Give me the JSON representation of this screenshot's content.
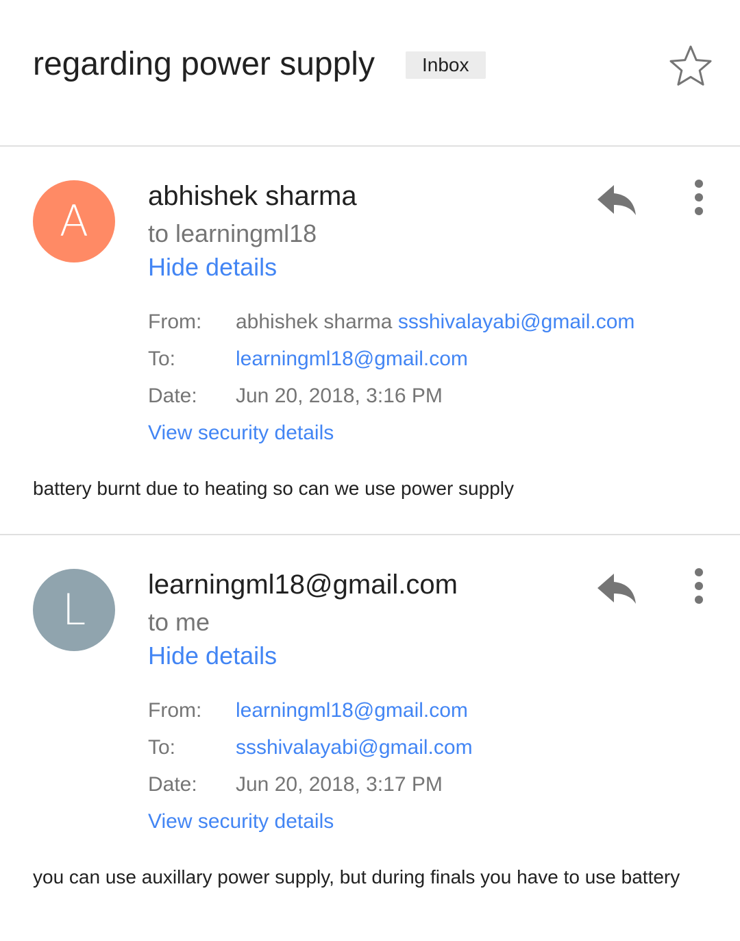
{
  "subject": "regarding power supply",
  "label": "Inbox",
  "colors": {
    "link": "#4285f4",
    "avatar_a": "#ff8a65",
    "avatar_l": "#90a4ae",
    "muted": "#757575"
  },
  "messages": [
    {
      "avatar_letter": "A",
      "sender": "abhishek sharma",
      "recipient_summary": "to learningml18",
      "hide_details": "Hide details",
      "from_label": "From:",
      "from_name": "abhishek sharma",
      "from_email": "ssshivalayabi@gmail.com",
      "to_label": "To:",
      "to_email": "learningml18@gmail.com",
      "date_label": "Date:",
      "date": "Jun 20, 2018, 3:16 PM",
      "security": "View security details",
      "body": "battery burnt due to heating so can we use power supply"
    },
    {
      "avatar_letter": "L",
      "sender": "learningml18@gmail.com",
      "recipient_summary": "to me",
      "hide_details": "Hide details",
      "from_label": "From:",
      "from_name": "",
      "from_email": "learningml18@gmail.com",
      "to_label": "To:",
      "to_email": "ssshivalayabi@gmail.com",
      "date_label": "Date:",
      "date": "Jun 20, 2018, 3:17 PM",
      "security": "View security details",
      "body": "you can use auxillary power supply, but during finals you have to use battery"
    }
  ]
}
